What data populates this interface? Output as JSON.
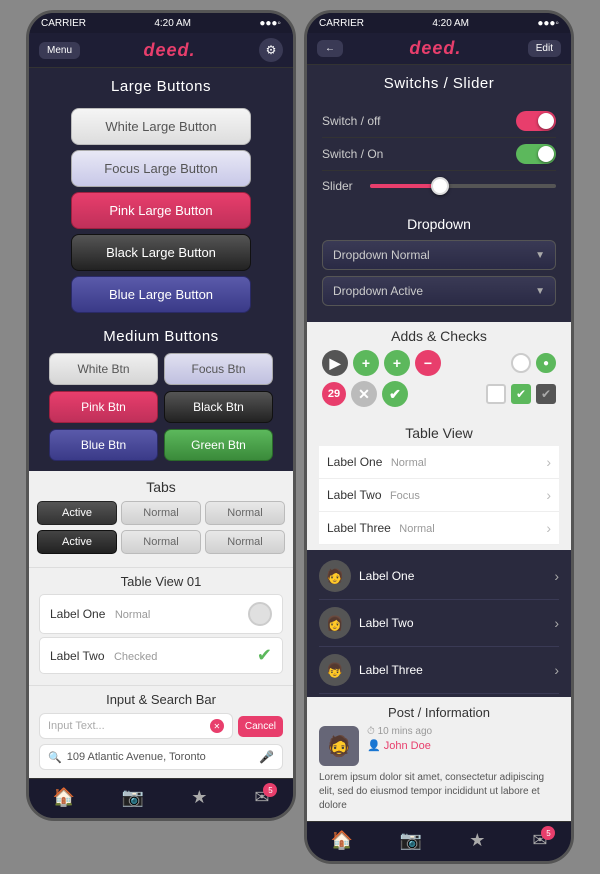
{
  "left_phone": {
    "status": {
      "carrier": "CARRIER",
      "time": "4:20 AM",
      "signal": "●●●●"
    },
    "nav": {
      "menu": "Menu",
      "logo": "deed.",
      "icon": "⚙"
    },
    "sections": {
      "large_buttons": {
        "title": "Large Buttons",
        "buttons": [
          {
            "label": "White Large Button",
            "style": "white"
          },
          {
            "label": "Focus Large Button",
            "style": "focus"
          },
          {
            "label": "Pink Large Button",
            "style": "pink"
          },
          {
            "label": "Black Large Button",
            "style": "black"
          },
          {
            "label": "Blue Large Button",
            "style": "blue"
          }
        ]
      },
      "medium_buttons": {
        "title": "Medium Buttons",
        "buttons": [
          {
            "label": "White Btn",
            "style": "white"
          },
          {
            "label": "Focus Btn",
            "style": "focus"
          },
          {
            "label": "Pink Btn",
            "style": "pink"
          },
          {
            "label": "Black Btn",
            "style": "black"
          },
          {
            "label": "Blue Btn",
            "style": "blue"
          },
          {
            "label": "Green Btn",
            "style": "green"
          }
        ]
      },
      "tabs": {
        "title": "Tabs",
        "row1": [
          "Active",
          "Normal",
          "Normal"
        ],
        "row2": [
          "Active",
          "Normal",
          "Normal"
        ]
      },
      "table_view_01": {
        "title": "Table View 01",
        "rows": [
          {
            "label": "Label One",
            "sub": "Normal",
            "right": "toggle"
          },
          {
            "label": "Label Two",
            "sub": "Checked",
            "right": "check"
          }
        ]
      },
      "input_search": {
        "title": "Input & Search Bar",
        "input_placeholder": "Input Text...",
        "cancel_label": "Cancel",
        "search_placeholder": "109 Atlantic Avenue, Toronto"
      }
    },
    "tab_bar": {
      "items": [
        "🏠",
        "📷",
        "★",
        "✉"
      ],
      "badge_index": 3,
      "badge_count": "5"
    }
  },
  "right_phone": {
    "status": {
      "carrier": "CARRIER",
      "time": "4:20 AM"
    },
    "nav": {
      "back": "←",
      "logo": "deed.",
      "edit": "Edit"
    },
    "sections": {
      "switches_slider": {
        "title": "Switchs / Slider",
        "switch_off_label": "Switch / off",
        "switch_on_label": "Switch / On",
        "slider_label": "Slider",
        "slider_percent": 35
      },
      "dropdown": {
        "title": "Dropdown",
        "items": [
          "Dropdown Normal",
          "Dropdown Active"
        ]
      },
      "adds_checks": {
        "title": "Adds & Checks",
        "number_badge": "29"
      },
      "table_view": {
        "title": "Table View",
        "rows": [
          {
            "label": "Label One",
            "sub": "Normal"
          },
          {
            "label": "Label Two",
            "sub": "Focus"
          },
          {
            "label": "Label Three",
            "sub": "Normal"
          }
        ],
        "avatar_rows": [
          {
            "label": "Label One",
            "emoji": "🧑"
          },
          {
            "label": "Label Two",
            "emoji": "👩"
          },
          {
            "label": "Label Three",
            "emoji": "👦"
          }
        ]
      },
      "post": {
        "title": "Post / Information",
        "time": "10 mins ago",
        "author": "John Doe",
        "body": "Lorem ipsum dolor sit amet, consectetur adipiscing elit, sed do eiusmod tempor incididunt ut labore et dolore"
      }
    },
    "tab_bar": {
      "items": [
        "🏠",
        "📷",
        "★",
        "✉"
      ],
      "badge_index": 3,
      "badge_count": "5"
    }
  }
}
